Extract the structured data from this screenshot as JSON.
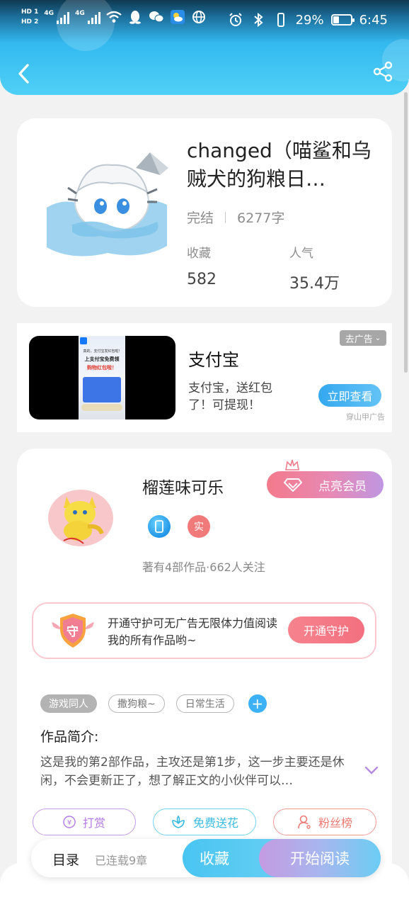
{
  "status_bar": {
    "hd1": "HD 1",
    "hd2": "HD 2",
    "net1": "4G",
    "net2": "4G",
    "battery_pct": "29%",
    "time": "6:45"
  },
  "header": {
    "back_icon": "chevron-left-icon",
    "share_icon": "share-icon"
  },
  "book": {
    "title": "changed（喵鲨和乌贼犬的狗粮日…",
    "status": "完结",
    "word_count": "6277字",
    "collect_label": "收藏",
    "collect_value": "582",
    "popularity_label": "人气",
    "popularity_value": "35.4万"
  },
  "ad": {
    "close_label": "去广告",
    "title": "支付宝",
    "desc": "支付宝，送红包了！可提现！",
    "cta": "立即查看",
    "source": "穿山甲广告",
    "poster_line1": "真的，支付宝发红包啦！",
    "poster_line2": "上支付宝免费领",
    "poster_line3": "购物红包啦！"
  },
  "author": {
    "name": "榴莲味可乐",
    "vip_label": "点亮会员",
    "badge_real": "实",
    "stats": "著有4部作品·662人关注",
    "guard_text": "开通守护可无广告无限体力值阅读我的所有作品哟~",
    "guard_icon_text": "守",
    "guard_btn": "开通守护",
    "tags": [
      "游戏同人",
      "撒狗粮~",
      "日常生活"
    ],
    "tag_add": "+",
    "intro_title": "作品简介:",
    "intro_text": "这是我的第2部作品，主攻还是第1步，这一步主要还是休闲，不会更新正了，想了解正文的小伙伴可以…",
    "actions": {
      "reward": "打赏",
      "flower": "免费送花",
      "fans": "粉丝榜"
    }
  },
  "bottom_bar": {
    "toc": "目录",
    "serial": "已连载9章",
    "favorite": "收藏",
    "read": "开始阅读"
  },
  "colors": {
    "header_accent": "#33b9ef",
    "vip_gradient_start": "#f47a8c",
    "guard_pink": "#f3707f",
    "tag_add_blue": "#3db1f5"
  }
}
